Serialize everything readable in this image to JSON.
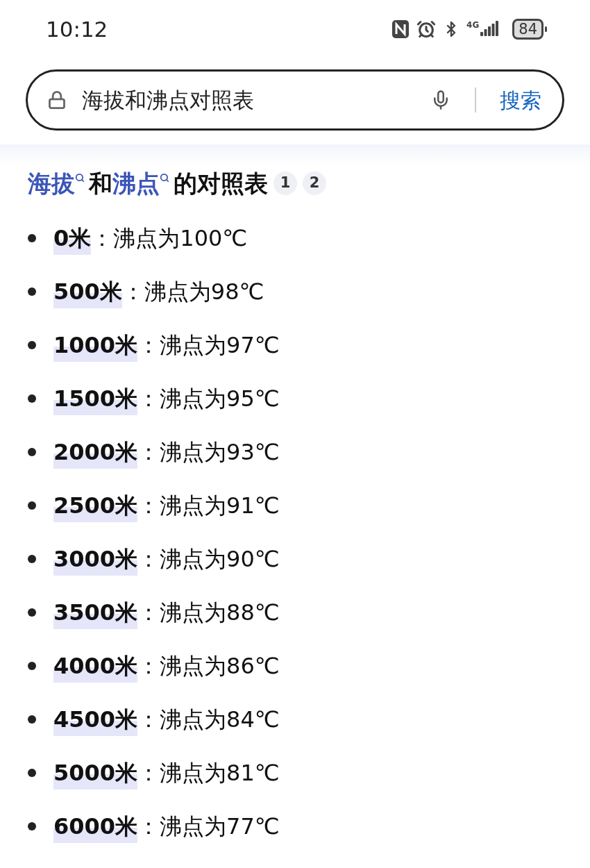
{
  "status_bar": {
    "time": "10:12",
    "network": "4G",
    "battery": "84"
  },
  "search": {
    "value": "海拔和沸点对照表",
    "button": "搜索"
  },
  "heading": {
    "segments": [
      {
        "text": "海拔",
        "kind": "link"
      },
      {
        "text": "和",
        "kind": "plain"
      },
      {
        "text": "沸点",
        "kind": "link"
      },
      {
        "text": "的对照表",
        "kind": "plain"
      }
    ],
    "citations": [
      "1",
      "2"
    ]
  },
  "items": [
    {
      "altitude": "0米",
      "text": "：沸点为100℃"
    },
    {
      "altitude": "500米",
      "text": "：沸点为98℃"
    },
    {
      "altitude": "1000米",
      "text": "：沸点为97℃"
    },
    {
      "altitude": "1500米",
      "text": "：沸点为95℃"
    },
    {
      "altitude": "2000米",
      "text": "：沸点为93℃"
    },
    {
      "altitude": "2500米",
      "text": "：沸点为91℃"
    },
    {
      "altitude": "3000米",
      "text": "：沸点为90℃"
    },
    {
      "altitude": "3500米",
      "text": "：沸点为88℃"
    },
    {
      "altitude": "4000米",
      "text": "：沸点为86℃"
    },
    {
      "altitude": "4500米",
      "text": "：沸点为84℃"
    },
    {
      "altitude": "5000米",
      "text": "：沸点为81℃"
    },
    {
      "altitude": "6000米",
      "text": "：沸点为77℃"
    }
  ]
}
